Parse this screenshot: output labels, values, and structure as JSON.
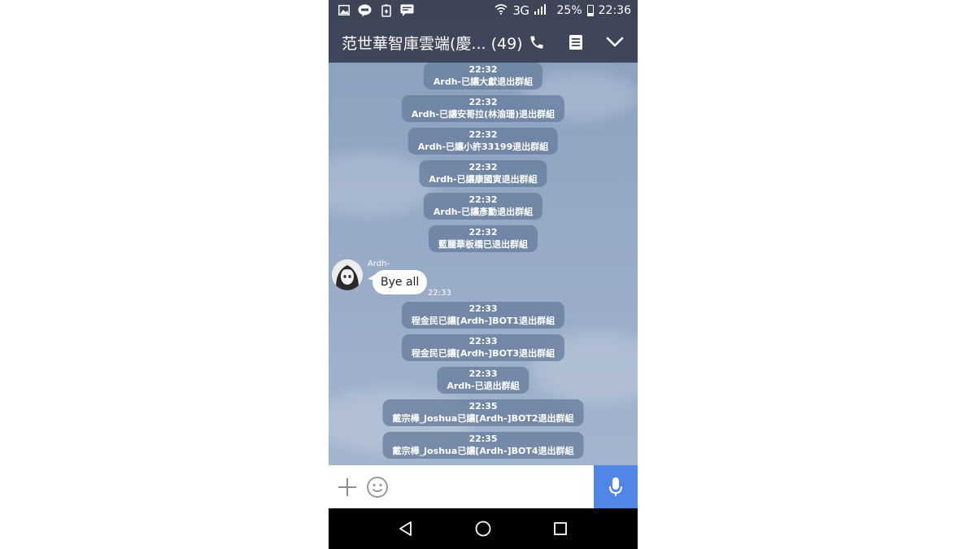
{
  "status_bar": {
    "network": "3G",
    "battery": "25%",
    "battery_level": 0.25,
    "time": "22:36",
    "left_icons": [
      "image-icon",
      "line-app-icon",
      "battery-saver-icon",
      "message-icon"
    ]
  },
  "header": {
    "title": "范世華智庫雲端(慶... (49)",
    "icons": [
      "phone-icon",
      "notes-icon",
      "chevron-down-icon"
    ]
  },
  "messages": [
    {
      "time": "22:32",
      "text": "Ardh-已讓大獻退出群組"
    },
    {
      "time": "22:32",
      "text": "Ardh-已讓安哥拉(林渝珊)退出群組"
    },
    {
      "time": "22:32",
      "text": "Ardh-已讓小許33199退出群組"
    },
    {
      "time": "22:32",
      "text": "Ardh-已讓康國寅退出群組"
    },
    {
      "time": "22:32",
      "text": "Ardh-已讓彥勳退出群組"
    },
    {
      "time": "22:32",
      "text": "藍麗華板橋已退出群組"
    },
    {
      "time": "22:33",
      "text": "程金民已讓[Ardh-]BOT1退出群組"
    },
    {
      "time": "22:33",
      "text": "程金民已讓[Ardh-]BOT3退出群組"
    },
    {
      "time": "22:33",
      "text": "Ardh-已退出群組"
    },
    {
      "time": "22:35",
      "text": "戴宗樺_Joshua已讓[Ardh-]BOT2退出群組"
    },
    {
      "time": "22:35",
      "text": "戴宗樺_Joshua已讓[Ardh-]BOT4退出群組"
    }
  ],
  "user_message": {
    "sender": "Ardh-",
    "text": "Bye all",
    "time": "22:33"
  },
  "input_bar": {
    "placeholder": "",
    "icons": [
      "plus-icon",
      "emoji-icon",
      "microphone-icon"
    ]
  },
  "nav_bar": {
    "icons": [
      "back-icon",
      "home-icon",
      "recents-icon"
    ]
  },
  "colors": {
    "header": "#3f4659",
    "chat_bg": "#8ea2c0",
    "system_bubble": "#687d9e",
    "mic_button": "#4f86e8"
  }
}
